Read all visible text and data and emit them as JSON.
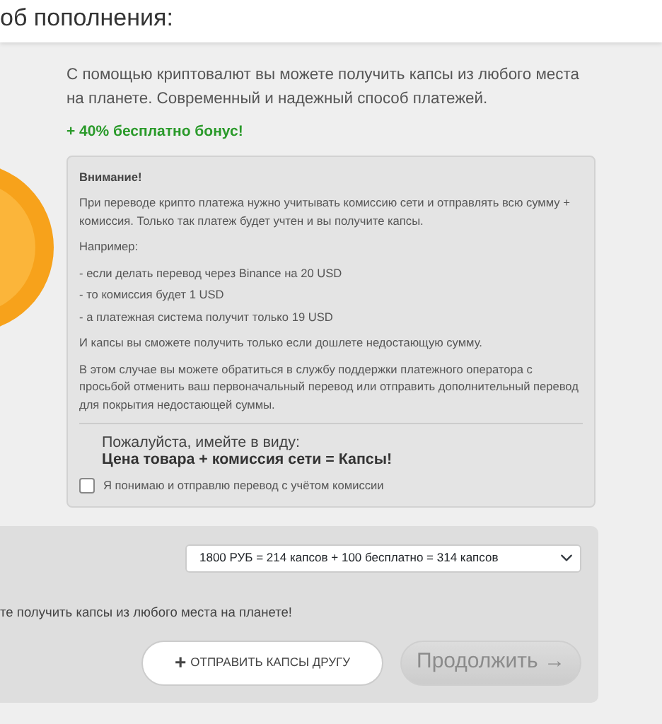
{
  "header": {
    "title": "об пополнения:"
  },
  "intro": {
    "text": "С помощью криптовалют вы можете получить капсы из любого места на планете. Современный и надежный способ платежей.",
    "bonus": "+ 40% бесплатно бонус!"
  },
  "warning": {
    "title": "Внимание!",
    "paragraphs": [
      "При переводе крипто платежа нужно учитывать комиссию сети и отправлять всю сумму + комиссия. Только так платеж будет учтен и вы получите капсы.",
      "Например:"
    ],
    "example": [
      "- если делать перевод через Binance на 20 USD",
      "- то комиссия будет 1 USD",
      "- а платежная система получит только 19 USD"
    ],
    "after": [
      "И капсы вы сможете получить только если дошлете недостающую сумму.",
      "В этом случае вы можете обратиться в службу поддержки платежного оператора с просьбой отменить ваш первоначальный перевод или отправить дополнительный перевод для покрытия недостающей суммы."
    ],
    "note": "Пожалуйста, имейте в виду:",
    "formula": "Цена товара + комиссия сети = Капсы!",
    "agree": {
      "label": "Я понимаю и отправлю перевод с учётом комиссии",
      "checked": false
    }
  },
  "package_select": {
    "value": "1800 РУБ = 214 капсов + 100 бесплатно = 314 капсов"
  },
  "footer_text": "те получить капсы из любого места на планете!",
  "buttons": [
    {
      "kind": "gift",
      "icon": "+",
      "label": "ОТПРАВИТЬ КАПСЫ ДРУГУ",
      "disabled": false
    },
    {
      "kind": "continue",
      "label": "Продолжить →",
      "disabled": true
    }
  ]
}
